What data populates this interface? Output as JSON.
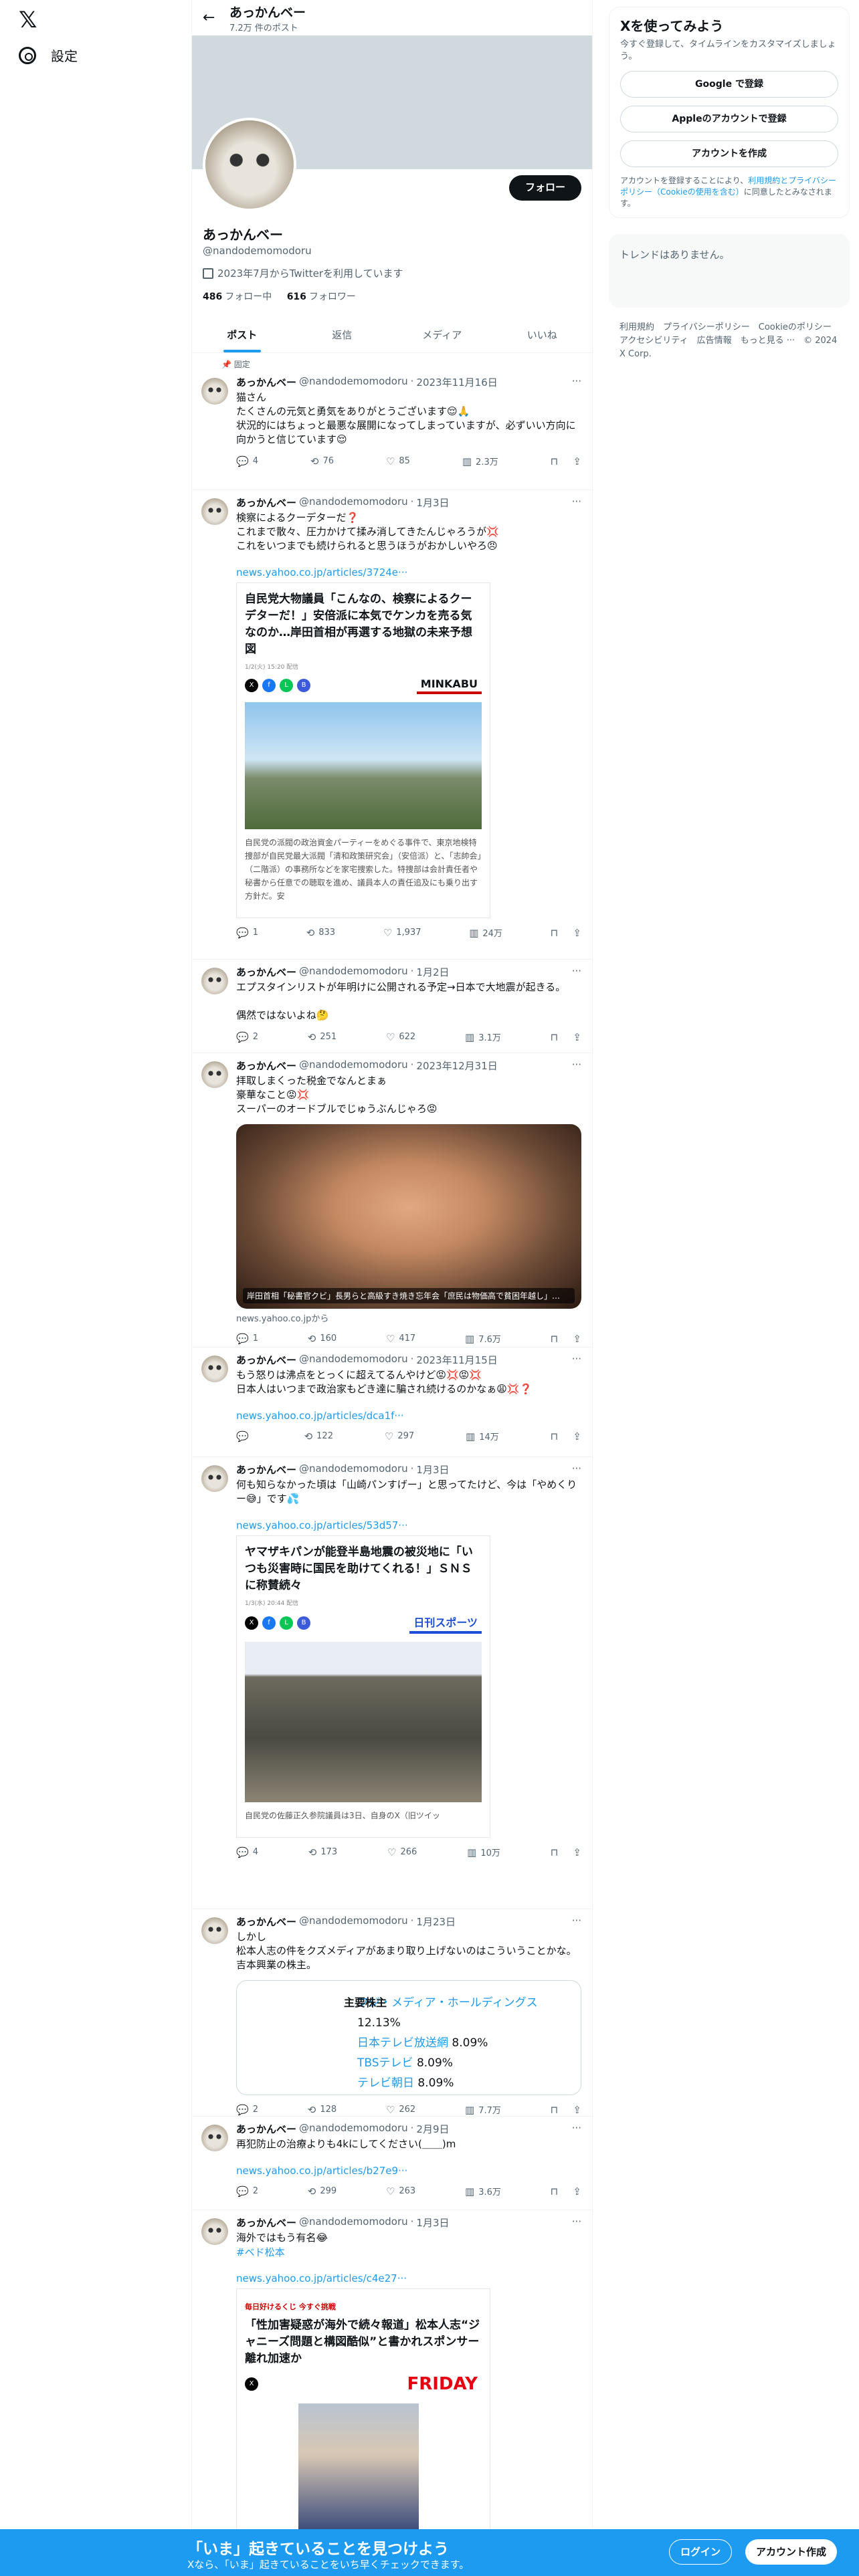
{
  "sidebar": {
    "settings_label": "設定"
  },
  "topbar": {
    "name": "あっかんベー",
    "post_count": "7.2万 件のポスト"
  },
  "profile": {
    "name": "あっかんベー",
    "handle": "@nandodemomodoru",
    "follow_label": "フォロー",
    "joined": "2023年7月からTwitterを利用しています",
    "following_count": "486",
    "following_label": "フォロー中",
    "followers_count": "616",
    "followers_label": "フォロワー"
  },
  "tabs": [
    "ポスト",
    "返信",
    "メディア",
    "いいね"
  ],
  "pinned_label": "固定",
  "tweets": [
    {
      "name": "あっかんベー",
      "handle": "@nandodemomodoru",
      "date": "2023年11月16日",
      "text": "猫さん\nたくさんの元気と勇気をありがとうございます😌🙏\n状況的にはちょっと最悪な展開になってしまっていますが、必ずいい方向に向かうと信じています😌",
      "reply": "4",
      "rt": "76",
      "like": "85",
      "views": "2.3万"
    },
    {
      "name": "あっかんベー",
      "handle": "@nandodemomodoru",
      "date": "1月3日",
      "text": "検察によるクーデターだ❓\nこれまで散々、圧力かけて揉み消してきたんじゃろうが💢\nこれをいつまでも続けられると思うほうがおかしいやろ😠",
      "link": "news.yahoo.co.jp/articles/3724e···",
      "card_title": "自民党大物議員「こんなの、検察によるクーデターだ！」安倍派に本気でケンカを売る気なのか…岸田首相が再選する地獄の未来予想図",
      "card_meta": "1/2(火) 15:20 配信",
      "card_brand": "MINKABU",
      "card_body": "自民党の派閥の政治資金パーティーをめぐる事件で、東京地検特捜部が自民党最大派閥「清和政策研究会」（安倍派）と、「志帥会」（二階派）の事務所などを家宅捜索した。特捜部は会計責任者や秘書から任意での聴取を進め、議員本人の責任追及にも乗り出す方針だ。安",
      "reply": "1",
      "rt": "833",
      "like": "1,937",
      "views": "24万"
    },
    {
      "name": "あっかんベー",
      "handle": "@nandodemomodoru",
      "date": "1月2日",
      "text": "エプスタインリストが年明けに公開される予定→日本で大地震が起きる。\n\n偶然ではないよね🤔",
      "reply": "2",
      "rt": "251",
      "like": "622",
      "views": "3.1万"
    },
    {
      "name": "あっかんベー",
      "handle": "@nandodemomodoru",
      "date": "2023年12月31日",
      "text": "拝取しまくった税金でなんとまぁ\n豪華なこと😡💢\nスーパーのオードブルでじゅうぶんじゃろ😡",
      "photo_caption": "岸田首相「秘書官クビ」長男らと高級すき焼き忘年会「庶民は物価高で貧困年越し」…",
      "from": "news.yahoo.co.jpから",
      "reply": "1",
      "rt": "160",
      "like": "417",
      "views": "7.6万"
    },
    {
      "name": "あっかんベー",
      "handle": "@nandodemomodoru",
      "date": "2023年11月15日",
      "text": "もう怒りは沸点をとっくに超えてるんやけど😡💢😡💢\n日本人はいつまで政治家もどき達に騙され続けるのかなぁ😩💢❓",
      "link": "news.yahoo.co.jp/articles/dca1f···",
      "reply": "",
      "rt": "122",
      "like": "297",
      "views": "14万"
    },
    {
      "name": "あっかんベー",
      "handle": "@nandodemomodoru",
      "date": "1月3日",
      "text": "何も知らなかった頃は「山崎パンすげー」と思ってたけど、今は「やめくりー😅」です💦",
      "link": "news.yahoo.co.jp/articles/53d57···",
      "card_title": "ヤマザキパンが能登半島地震の被災地に「いつも災害時に国民を助けてくれる！」ＳＮＳに称賛続々",
      "card_meta": "1/3(水) 20:44 配信",
      "card_brand": "日刊スポーツ",
      "card_body": "自民党の佐藤正久参院議員は3日、自身のX（旧ツイッ",
      "reply": "4",
      "rt": "173",
      "like": "266",
      "views": "10万"
    },
    {
      "name": "あっかんベー",
      "handle": "@nandodemomodoru",
      "date": "1月23日",
      "text": "しかし\n松本人志の件をクズメディアがあまり取り上げないのはこういうことかな。\n吉本興業の株主。",
      "table_label": "主要株主",
      "table_rows": [
        [
          "フジ・メディア・ホールディングス",
          "12.13%"
        ],
        [
          "日本テレビ放送網",
          "8.09%"
        ],
        [
          "TBSテレビ",
          "8.09%"
        ],
        [
          "テレビ朝日",
          "8.09%"
        ]
      ],
      "reply": "2",
      "rt": "128",
      "like": "262",
      "views": "7.7万"
    },
    {
      "name": "あっかんベー",
      "handle": "@nandodemomodoru",
      "date": "2月9日",
      "text": "再犯防止の治療よりも4kにしてください(＿＿)m",
      "link": "news.yahoo.co.jp/articles/b27e9···",
      "reply": "2",
      "rt": "299",
      "like": "263",
      "views": "3.6万"
    },
    {
      "name": "あっかんベー",
      "handle": "@nandodemomodoru",
      "date": "1月3日",
      "text": "海外ではもう有名😂",
      "hashtag": "#ベド松本",
      "link": "news.yahoo.co.jp/articles/c4e27···",
      "card_title": "「性加害疑惑が海外で続々報道」松本人志“ジャニーズ問題と構図酷似”と書かれスポンサー離れ加速か",
      "card_meta": "毎日好けるくじ 今すぐ挑戦",
      "card_brand": "FRIDAY"
    }
  ],
  "right": {
    "join_title": "Xを使ってみよう",
    "join_sub": "今すぐ登録して、タイムラインをカスタマイズしましょう。",
    "google_btn": "Google で登録",
    "apple_btn": "Appleのアカウントで登録",
    "create_btn": "アカウントを作成",
    "legal_pre": "アカウントを登録することにより、",
    "legal_link": "利用規約とプライバシーポリシー（Cookieの使用を含む）",
    "legal_post": "に同意したとみなされます。",
    "trend_empty": "トレンドはありません。",
    "footer": "利用規約　プライバシーポリシー　Cookieのポリシー　アクセシビリティ　広告情報　もっと見る ···　© 2024 X Corp."
  },
  "bottom": {
    "title": "「いま」起きていることを見つけよう",
    "sub": "Xなら、「いま」起きていることをいち早くチェックできます。",
    "login": "ログイン",
    "signup": "アカウント作成"
  }
}
